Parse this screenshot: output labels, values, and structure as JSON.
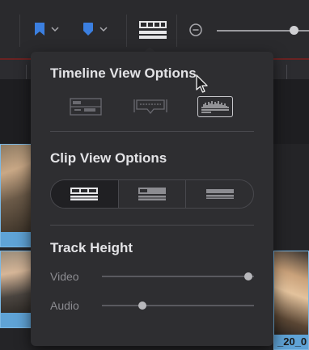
{
  "toolbar": {
    "flag_icon_color": "#3b7fe0",
    "marker_icon_color": "#3b7fe0",
    "zoom_level": 0.82
  },
  "timeline": {
    "clip_label_partial": "_20_0"
  },
  "popup": {
    "timeline_view": {
      "title": "Timeline View Options",
      "options": [
        "stacked-timelines",
        "subtitle-track",
        "audio-waveforms"
      ],
      "selected_index": 2
    },
    "clip_view": {
      "title": "Clip View Options",
      "options": [
        "filmstrip",
        "thumbnail",
        "simple"
      ],
      "selected_index": 0
    },
    "track_height": {
      "title": "Track Height",
      "video_label": "Video",
      "video_value": 1.0,
      "audio_label": "Audio",
      "audio_value": 0.3
    }
  },
  "colors": {
    "clip_blue": "#5fa3d6",
    "accent_blue": "#3b7fe0",
    "popup_bg": "#2e2e31"
  }
}
